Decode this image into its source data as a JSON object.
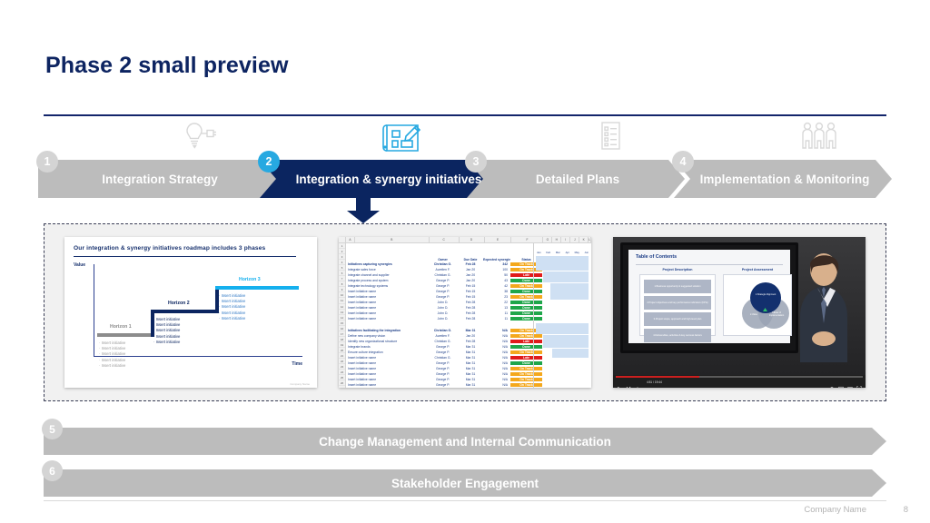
{
  "slide": {
    "title": "Phase 2 small preview",
    "accent_navy": "#0b2560",
    "accent_cyan": "#27a9e1",
    "grey": "#bcbcbc"
  },
  "process": {
    "steps": [
      {
        "number": "1",
        "label": "Integration Strategy",
        "state": "inactive",
        "icon": "lightbulb-plug-icon"
      },
      {
        "number": "2",
        "label": "Integration & synergy initiatives",
        "state": "active",
        "icon": "blueprint-pencil-icon"
      },
      {
        "number": "3",
        "label": "Detailed Plans",
        "state": "inactive",
        "icon": "checklist-document-icon"
      },
      {
        "number": "4",
        "label": "Implementation & Monitoring",
        "state": "inactive",
        "icon": "three-people-icon"
      }
    ],
    "down_arrow_icon": "arrow-down-icon"
  },
  "previews": {
    "roadmap": {
      "title": "Our integration & synergy initiatives roadmap includes 3 phases",
      "y_axis_label": "Value",
      "x_axis_label": "Time",
      "horizons": [
        {
          "name": "Horizon 1",
          "color": "#8c8c8c",
          "items": [
            "Insert initiative",
            "Insert initiative",
            "Insert initiative",
            "Insert initiative",
            "Insert initiative"
          ]
        },
        {
          "name": "Horizon 2",
          "color": "#0b2560",
          "items": [
            "Insert initiative",
            "Insert initiative",
            "Insert initiative",
            "Insert initiative",
            "Insert initiative"
          ]
        },
        {
          "name": "Horizon 3",
          "color": "#15b0ee",
          "items": [
            "Insert initiative",
            "Insert initiative",
            "Insert initiative",
            "Insert initiative",
            "Insert initiative"
          ]
        }
      ],
      "footer": "Company Name"
    },
    "tracker": {
      "spreadsheet_columns": [
        "A",
        "B",
        "C",
        "D",
        "E",
        "F",
        "G",
        "H",
        "I",
        "J",
        "K",
        "L"
      ],
      "headers": [
        "",
        "Owner",
        "Due Date",
        "Expected synergies ($M)",
        "Status"
      ],
      "gantt_months": [
        "Jan",
        "Feb",
        "Mar",
        "Apr",
        "May",
        "Jun"
      ],
      "sections": [
        {
          "title": "Initiatives capturing synergies",
          "owner": "Christian G.",
          "due": "Feb 28",
          "synergies": "342",
          "status": "On Track",
          "rows": [
            {
              "n": "1",
              "name": "Integrate sales force",
              "owner": "Aurelien F.",
              "due": "Jan 20",
              "syn": "100",
              "status": "On Track",
              "color": "#f4a81d"
            },
            {
              "n": "2",
              "name": "Integrate channel and supplier",
              "owner": "Christian G.",
              "due": "Jan 20",
              "syn": "50",
              "status": "Late",
              "color": "#e01b1b"
            },
            {
              "n": "3",
              "name": "Integrate process and system",
              "owner": "George P.",
              "due": "Jan 20",
              "syn": "43",
              "status": "Done",
              "color": "#1fa64a"
            },
            {
              "n": "4",
              "name": "Integrate technology systems",
              "owner": "George P.",
              "due": "Feb 15",
              "syn": "42",
              "status": "On Track",
              "color": "#f4a81d"
            },
            {
              "n": "5",
              "name": "Insert initiative name",
              "owner": "George P.",
              "due": "Feb 15",
              "syn": "38",
              "status": "Done",
              "color": "#1fa64a"
            },
            {
              "n": "6",
              "name": "Insert initiative name",
              "owner": "George P.",
              "due": "Feb 15",
              "syn": "23",
              "status": "On Track",
              "color": "#f4a81d"
            },
            {
              "n": "7",
              "name": "Insert initiative name",
              "owner": "John D.",
              "due": "Feb 28",
              "syn": "22",
              "status": "Done",
              "color": "#1fa64a"
            },
            {
              "n": "8",
              "name": "Insert initiative name",
              "owner": "John D.",
              "due": "Feb 28",
              "syn": "13",
              "status": "Done",
              "color": "#1fa64a"
            },
            {
              "n": "9",
              "name": "Insert initiative name",
              "owner": "John D.",
              "due": "Feb 28",
              "syn": "11",
              "status": "Done",
              "color": "#1fa64a"
            },
            {
              "n": "10",
              "name": "Insert initiative name",
              "owner": "John D.",
              "due": "Feb 28",
              "syn": "11",
              "status": "Done",
              "color": "#1fa64a"
            }
          ]
        },
        {
          "title": "Initiatives facilitating the integration",
          "owner": "Christian G.",
          "due": "Mar 31",
          "synergies": "N/A",
          "status": "On Track",
          "rows": [
            {
              "n": "1",
              "name": "Define new company vision",
              "owner": "Aurelien F.",
              "due": "Jan 20",
              "syn": "N/A",
              "status": "On Track",
              "color": "#f4a81d"
            },
            {
              "n": "2",
              "name": "Identify new organizational structure",
              "owner": "Christian G.",
              "due": "Feb 28",
              "syn": "N/A",
              "status": "Late",
              "color": "#e01b1b"
            },
            {
              "n": "3",
              "name": "Integrate brands",
              "owner": "George P.",
              "due": "Mar 31",
              "syn": "N/A",
              "status": "Done",
              "color": "#1fa64a"
            },
            {
              "n": "4",
              "name": "Ensure culture integration",
              "owner": "George P.",
              "due": "Mar 31",
              "syn": "N/A",
              "status": "On Track",
              "color": "#f4a81d"
            },
            {
              "n": "5",
              "name": "Insert initiative name",
              "owner": "Christian G.",
              "due": "Mar 31",
              "syn": "N/A",
              "status": "Late",
              "color": "#e01b1b"
            },
            {
              "n": "6",
              "name": "Insert initiative name",
              "owner": "George P.",
              "due": "Mar 31",
              "syn": "N/A",
              "status": "Done",
              "color": "#1fa64a"
            },
            {
              "n": "7",
              "name": "Insert initiative name",
              "owner": "George P.",
              "due": "Mar 31",
              "syn": "N/A",
              "status": "On Track",
              "color": "#f4a81d"
            },
            {
              "n": "8",
              "name": "Insert initiative name",
              "owner": "George P.",
              "due": "Mar 31",
              "syn": "N/A",
              "status": "On Track",
              "color": "#f4a81d"
            },
            {
              "n": "9",
              "name": "Insert initiative name",
              "owner": "George P.",
              "due": "Mar 31",
              "syn": "N/A",
              "status": "On Track",
              "color": "#f4a81d"
            },
            {
              "n": "10",
              "name": "Insert initiative name",
              "owner": "George P.",
              "due": "Mar 31",
              "syn": "N/A",
              "status": "On Track",
              "color": "#f4a81d"
            }
          ]
        }
      ]
    },
    "video": {
      "slide_title": "Table of Contents",
      "left_column_title": "Project Description",
      "right_column_title": "Project Assessment",
      "items": [
        "1.Business opportunity & suggested solution",
        "2.Project objectives and key performance indicators (KPIs)",
        "3.Project scope, approach and high-level plan",
        "4.Deliverables, activities & key success factors"
      ],
      "venn": [
        {
          "label": "1.Strategic Alignment",
          "color": "#13306e"
        },
        {
          "label": "2.Value",
          "color": "#9aa3b4"
        },
        {
          "label": "3.Ease of Implementation",
          "color": "#9aa3b4"
        }
      ],
      "time": "4:51 / 19:44",
      "play_icon": "play-icon",
      "next_icon": "next-icon",
      "volume_icon": "volume-icon",
      "settings_icon": "gear-icon",
      "theater_icon": "theater-mode-icon",
      "miniplayer_icon": "miniplayer-icon",
      "fullscreen_icon": "fullscreen-icon"
    }
  },
  "bottom_bars": [
    {
      "number": "5",
      "label": "Change Management and Internal Communication"
    },
    {
      "number": "6",
      "label": "Stakeholder Engagement"
    }
  ],
  "footer": {
    "company": "Company Name",
    "page": "8"
  }
}
